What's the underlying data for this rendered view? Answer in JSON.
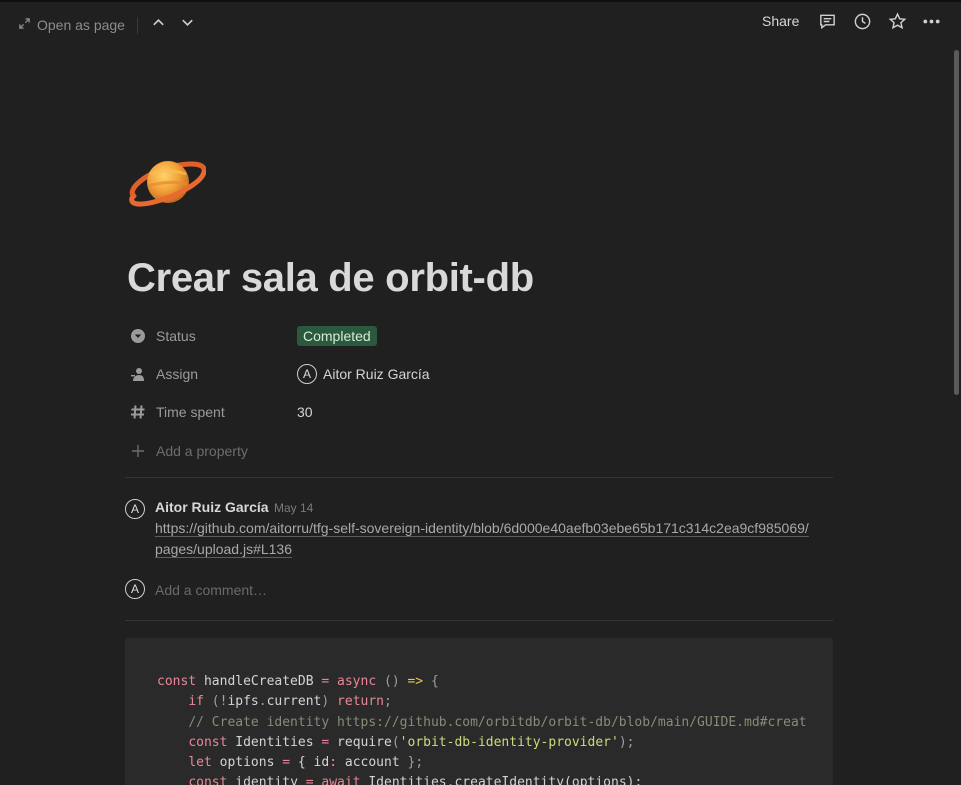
{
  "topbar": {
    "open_as_page": "Open as page",
    "share": "Share",
    "icons": [
      "expand-icon",
      "chevron-up-icon",
      "chevron-down-icon",
      "comment-icon",
      "history-icon",
      "star-icon",
      "more-icon"
    ]
  },
  "page": {
    "icon": "ringed-planet-icon",
    "title": "Crear sala de orbit-db"
  },
  "properties": {
    "status": {
      "label": "Status",
      "value": "Completed",
      "color": "#2b593f"
    },
    "assign": {
      "label": "Assign",
      "avatar": "A",
      "value": "Aitor Ruiz García"
    },
    "time_spent": {
      "label": "Time spent",
      "value": "30"
    },
    "add_property": "Add a property"
  },
  "comment": {
    "avatar": "A",
    "author": "Aitor Ruiz García",
    "date": "May 14",
    "link": "https://github.com/aitorru/tfg-self-sovereign-identity/blob/6d000e40aefb03ebe65b171c314c2ea9cf985069/pages/upload.js#L136"
  },
  "new_comment": {
    "avatar": "A",
    "placeholder": "Add a comment…"
  },
  "code": {
    "line1": {
      "kw1": "const",
      "name": "handleCreateDB",
      "op": "=",
      "kw2": "async",
      "parens": "()",
      "arrow": "=>",
      "brace": "{"
    },
    "line2": {
      "kw": "if",
      "open": "(",
      "bang": "!",
      "expr": "ipfs",
      "dot": ".",
      "prop": "current",
      "close": ")",
      "kw2": "return",
      "semi": ";"
    },
    "line3": {
      "comment": "// Create identity https://github.com/orbitdb/orbit-db/blob/main/GUIDE.md#creat"
    },
    "line4": {
      "kw": "const",
      "name": "Identities",
      "op": "=",
      "call": "require",
      "open": "(",
      "str": "'orbit-db-identity-provider'",
      "close": ");"
    },
    "line5": {
      "kw": "let",
      "name": "options",
      "op": "=",
      "open": "{ id",
      "colon": ":",
      "val": "account",
      "close": "};"
    },
    "line6": {
      "kw": "const",
      "name": "identity",
      "op": "=",
      "kw2": "await",
      "obj": "Identities",
      "dot": ".",
      "call": "createIdentity",
      "args": "(options);"
    }
  }
}
